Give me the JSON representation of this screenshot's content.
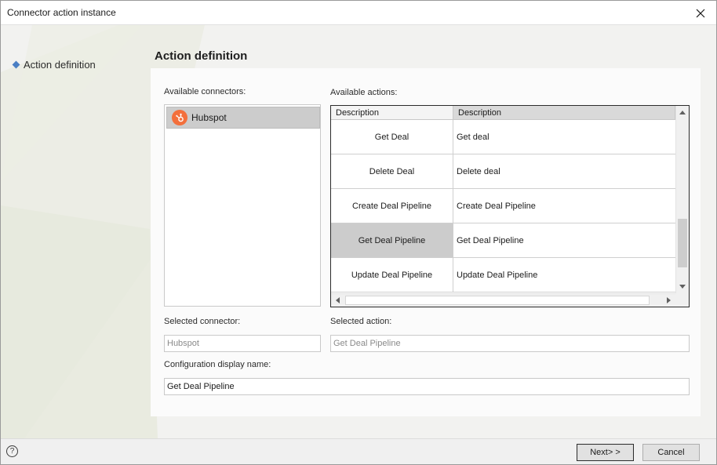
{
  "window": {
    "title": "Connector action instance"
  },
  "nav": {
    "items": [
      {
        "label": "Action definition"
      }
    ]
  },
  "section_title": "Action definition",
  "connectors": {
    "label": "Available connectors:",
    "items": [
      {
        "name": "Hubspot",
        "icon": "hubspot-logo-icon"
      }
    ]
  },
  "actions": {
    "label": "Available actions:",
    "columns": [
      "Description",
      "Description"
    ],
    "rows": [
      {
        "name": "Get Deal",
        "description": "Get deal"
      },
      {
        "name": "Delete Deal",
        "description": "Delete deal"
      },
      {
        "name": "Create Deal Pipeline",
        "description": "Create Deal Pipeline"
      },
      {
        "name": "Get Deal Pipeline",
        "description": "Get Deal Pipeline",
        "selected": true
      },
      {
        "name": "Update Deal Pipeline",
        "description": "Update Deal Pipeline"
      }
    ]
  },
  "selected_connector": {
    "label": "Selected connector:",
    "value": "Hubspot"
  },
  "selected_action": {
    "label": "Selected action:",
    "value": "Get Deal Pipeline"
  },
  "display_name": {
    "label": "Configuration display name:",
    "value": "Get Deal Pipeline"
  },
  "footer": {
    "help_label": "?",
    "next_label": "Next> >",
    "cancel_label": "Cancel"
  },
  "colors": {
    "accent": "#4b7fc4",
    "hubspot": "#f36f3c",
    "selection": "#cccccc"
  }
}
